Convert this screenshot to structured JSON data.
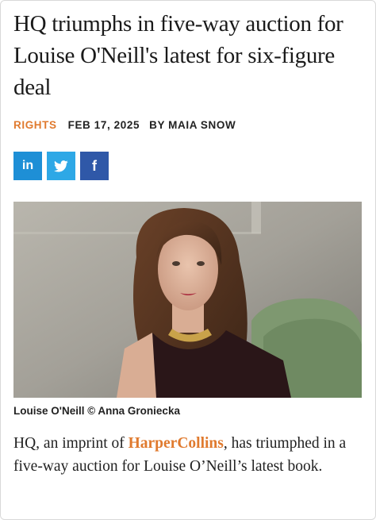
{
  "article": {
    "headline": "HQ triumphs in five-way auction for Louise O'Neill's latest for six-figure deal",
    "category": "RIGHTS",
    "date": "FEB 17, 2025",
    "byline": "BY MAIA SNOW",
    "share": [
      {
        "network": "linkedin",
        "label": "in",
        "color": "#1e8fd6"
      },
      {
        "network": "twitter",
        "icon": "twitter-bird-icon",
        "color": "#2ea8e6"
      },
      {
        "network": "facebook",
        "label": "f",
        "color": "#2f58a8"
      }
    ],
    "image_caption": "Louise O'Neill © Anna Groniecka",
    "lede_before": "HQ, an imprint of ",
    "lede_link": "HarperCollins",
    "lede_after": ", has triumphed in a five-way auction for Louise O’Neill’s latest book.",
    "accent_color": "#e07a2e"
  }
}
